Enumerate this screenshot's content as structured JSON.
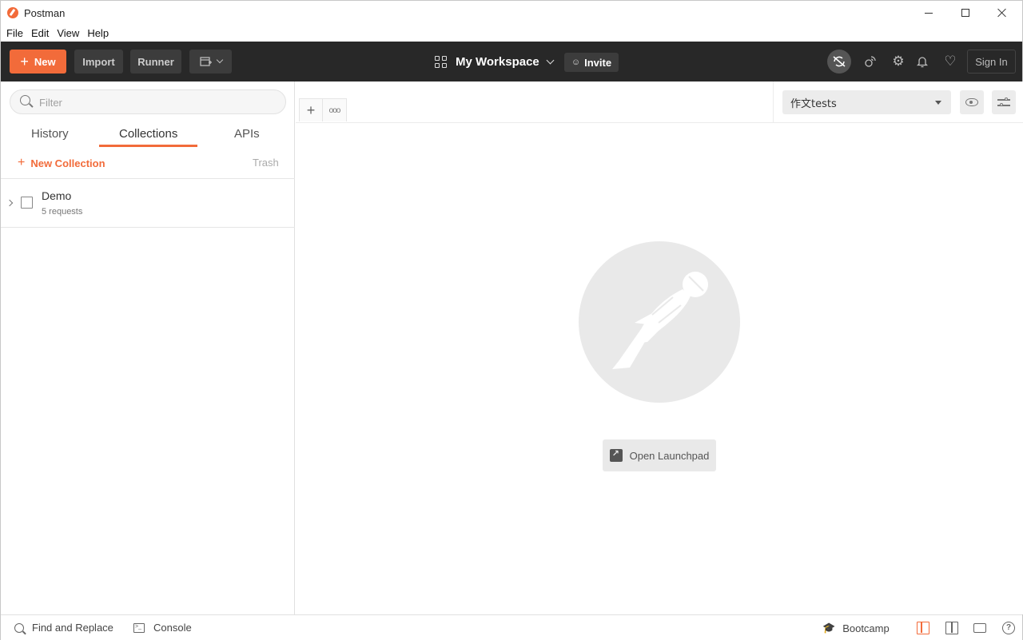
{
  "window": {
    "title": "Postman"
  },
  "menu": [
    "File",
    "Edit",
    "View",
    "Help"
  ],
  "header": {
    "new_label": "New",
    "import_label": "Import",
    "runner_label": "Runner",
    "workspace_label": "My Workspace",
    "invite_label": "Invite",
    "signin_label": "Sign In"
  },
  "sidebar": {
    "filter_placeholder": "Filter",
    "tabs": [
      "History",
      "Collections",
      "APIs"
    ],
    "active_tab": "Collections",
    "new_collection_label": "New Collection",
    "trash_label": "Trash",
    "collections": [
      {
        "name": "Demo",
        "meta": "5 requests"
      }
    ]
  },
  "main": {
    "environment": "作文tests",
    "open_launchpad_label": "Open Launchpad"
  },
  "statusbar": {
    "find_replace_label": "Find and Replace",
    "console_label": "Console",
    "bootcamp_label": "Bootcamp"
  },
  "colors": {
    "accent": "#f26b3a",
    "header_bg": "#282828",
    "button_dark": "#3c3c3c"
  }
}
